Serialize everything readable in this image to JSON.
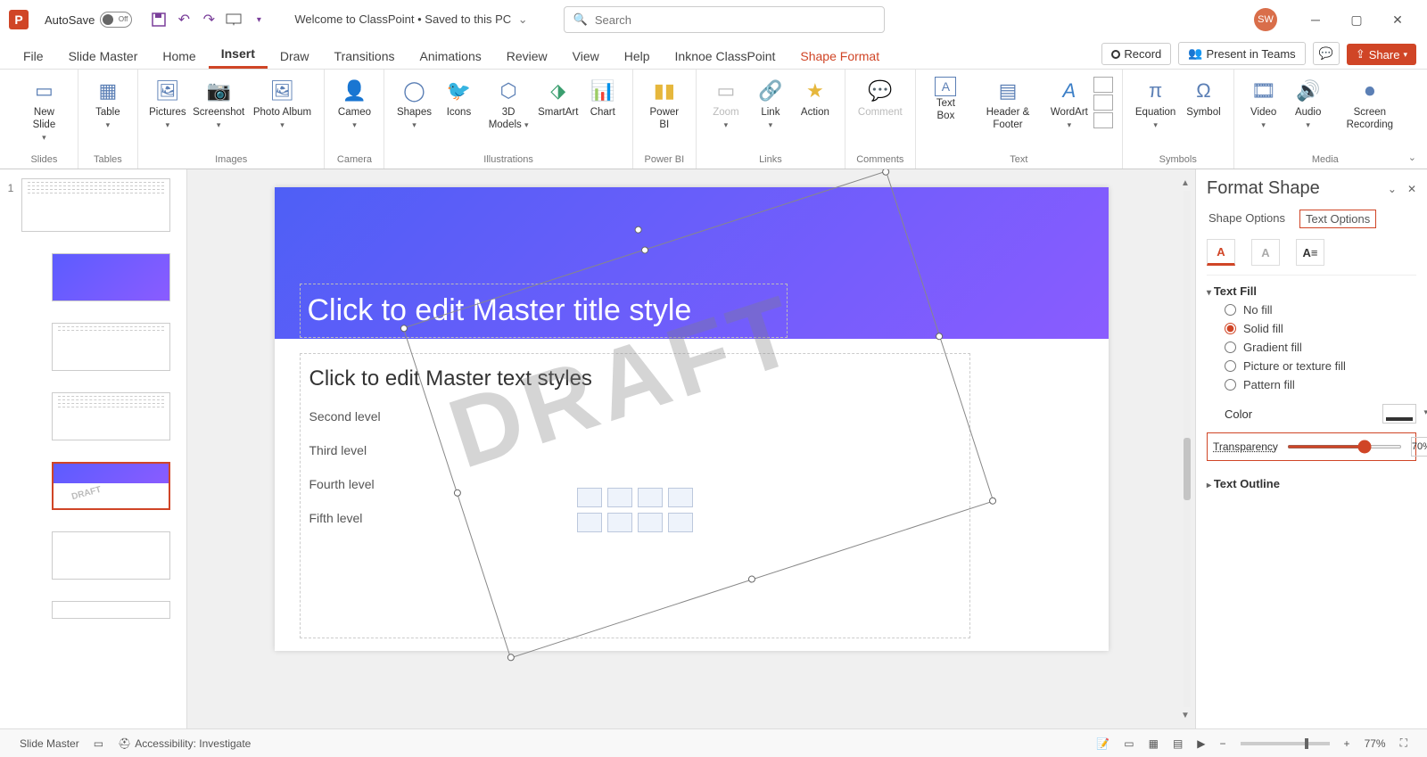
{
  "titlebar": {
    "app_letter": "P",
    "autosave_label": "AutoSave",
    "autosave_state": "Off",
    "doc_title": "Welcome to ClassPoint • Saved to this PC",
    "search_placeholder": "Search",
    "user_initials": "SW"
  },
  "menutabs": {
    "file": "File",
    "slide_master": "Slide Master",
    "home": "Home",
    "insert": "Insert",
    "draw": "Draw",
    "transitions": "Transitions",
    "animations": "Animations",
    "review": "Review",
    "view": "View",
    "help": "Help",
    "classpoint": "Inknoe ClassPoint",
    "shape_format": "Shape Format",
    "record": "Record",
    "present_teams": "Present in Teams",
    "share": "Share"
  },
  "ribbon": {
    "slides": {
      "label": "Slides",
      "new_slide": "New Slide"
    },
    "tables": {
      "label": "Tables",
      "table": "Table"
    },
    "images": {
      "label": "Images",
      "pictures": "Pictures",
      "screenshot": "Screenshot",
      "photo_album": "Photo Album"
    },
    "camera": {
      "label": "Camera",
      "cameo": "Cameo"
    },
    "illustrations": {
      "label": "Illustrations",
      "shapes": "Shapes",
      "icons": "Icons",
      "models": "3D Models",
      "smartart": "SmartArt",
      "chart": "Chart"
    },
    "powerbi": {
      "label": "Power BI",
      "powerbi": "Power BI"
    },
    "links": {
      "label": "Links",
      "zoom": "Zoom",
      "link": "Link",
      "action": "Action"
    },
    "comments": {
      "label": "Comments",
      "comment": "Comment"
    },
    "text": {
      "label": "Text",
      "textbox": "Text Box",
      "header_footer": "Header & Footer",
      "wordart": "WordArt"
    },
    "symbols": {
      "label": "Symbols",
      "equation": "Equation",
      "symbol": "Symbol"
    },
    "media": {
      "label": "Media",
      "video": "Video",
      "audio": "Audio",
      "screen_rec": "Screen Recording"
    }
  },
  "thumbs": {
    "slide_number": "1"
  },
  "slide": {
    "title_ph": "Click to edit Master title style",
    "body_l1": "Click to edit Master text styles",
    "l2": "Second level",
    "l3": "Third level",
    "l4": "Fourth level",
    "l5": "Fifth level",
    "draft": "DRAFT"
  },
  "fpane": {
    "title": "Format Shape",
    "tab_shape": "Shape Options",
    "tab_text": "Text Options",
    "text_fill": "Text Fill",
    "no_fill": "No fill",
    "solid_fill": "Solid fill",
    "gradient_fill": "Gradient fill",
    "picture_fill": "Picture or texture fill",
    "pattern_fill": "Pattern fill",
    "color": "Color",
    "transparency": "Transparency",
    "transparency_value": "70%",
    "text_outline": "Text Outline"
  },
  "statusbar": {
    "mode": "Slide Master",
    "accessibility": "Accessibility: Investigate",
    "zoom": "77%"
  }
}
